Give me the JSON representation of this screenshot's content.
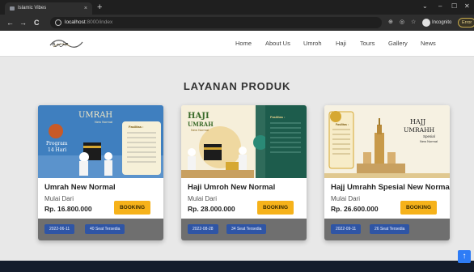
{
  "browser": {
    "tab_title": "Islamic Vibes",
    "tab_close": "×",
    "new_tab": "+",
    "window_controls": [
      "⌄",
      "–",
      "☐",
      "✕"
    ],
    "nav": {
      "back": "←",
      "forward": "→",
      "reload": "C"
    },
    "url_host": "localhost",
    "url_path": ":8000/index",
    "profile_label": "Incognito",
    "error_label": "Error"
  },
  "site": {
    "logo_text": "جزيرة",
    "menu": [
      "Home",
      "About Us",
      "Umroh",
      "Haji",
      "Tours",
      "Gallery",
      "News"
    ]
  },
  "section": {
    "title": "LAYANAN PRODUK"
  },
  "cards": [
    {
      "title": "Umrah New Normal",
      "from_label": "Mulai Dari",
      "price": "Rp. 16.800.000",
      "booking_label": "BOOKING",
      "date": "2022-06-11",
      "seats": "40 Seat Tersedia",
      "banner": {
        "heading": "UMRAH",
        "subheading": "New Normal",
        "program": "Program",
        "days": "14 Hari",
        "fasilitas": "Fasilitas :"
      }
    },
    {
      "title": "Haji Umroh New Normal",
      "from_label": "Mulai Dari",
      "price": "Rp. 28.000.000",
      "booking_label": "BOOKING",
      "date": "2022-08-28",
      "seats": "34 Seat Tersedia",
      "banner": {
        "heading": "HAJI",
        "subheading": "UMRAH",
        "tagline": "New Normal",
        "fasilitas": "Fasilitas :"
      }
    },
    {
      "title": "Hajj Umrahh Spesial New Normal",
      "from_label": "Mulai Dari",
      "price": "Rp. 26.600.000",
      "booking_label": "BOOKING",
      "date": "2022-09-11",
      "seats": "26 Seat Tersedia",
      "banner": {
        "heading": "HAJJ",
        "subheading": "UMRAHH",
        "special": "Spesial",
        "tagline": "New Normal",
        "fasilitas": "Fasilitas :"
      }
    }
  ],
  "scroll_top_label": "↑",
  "colors": {
    "accent_booking": "#f6b21a",
    "chip_blue": "#2f55a5",
    "footer_navy": "#141c2c",
    "scroll_blue": "#2e7cf6"
  }
}
